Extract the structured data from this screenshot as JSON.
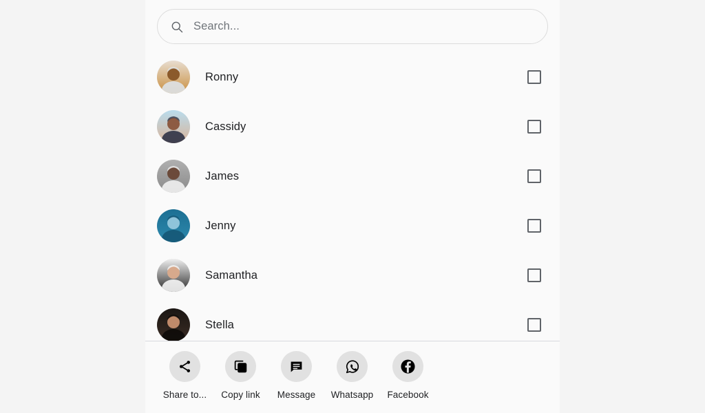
{
  "search": {
    "placeholder": "Search...",
    "value": "",
    "icon": "search-icon"
  },
  "contacts": [
    {
      "name": "Ronny",
      "checked": false,
      "avatar_colors": [
        "#e8ddd0",
        "#c98f3f",
        "#8b5a2b",
        "#dde4ea"
      ]
    },
    {
      "name": "Cassidy",
      "checked": false,
      "avatar_colors": [
        "#b9dced",
        "#d9b49a",
        "#8d5b43",
        "#2a2f43"
      ]
    },
    {
      "name": "James",
      "checked": false,
      "avatar_colors": [
        "#b0b0b0",
        "#8a8a8a",
        "#6b4a3a",
        "#f2f2f2"
      ]
    },
    {
      "name": "Jenny",
      "checked": false,
      "avatar_colors": [
        "#1c6f93",
        "#2d89ad",
        "#8fc4da",
        "#145574"
      ]
    },
    {
      "name": "Samantha",
      "checked": false,
      "avatar_colors": [
        "#efefef",
        "#2b2b2b",
        "#d7a98c",
        "#fafafa"
      ]
    },
    {
      "name": "Stella",
      "checked": false,
      "avatar_colors": [
        "#1b1613",
        "#3a2c24",
        "#c08a6a",
        "#0d0a08"
      ]
    }
  ],
  "share_actions": [
    {
      "label": "Share to...",
      "icon": "share-nodes-icon"
    },
    {
      "label": "Copy link",
      "icon": "copy-icon"
    },
    {
      "label": "Message",
      "icon": "message-bubble-icon"
    },
    {
      "label": "Whatsapp",
      "icon": "whatsapp-icon"
    },
    {
      "label": "Facebook",
      "icon": "facebook-icon"
    }
  ],
  "colors": {
    "page_background": "#f4f4f4",
    "sheet_background": "#fafafa",
    "text_primary": "#202124",
    "text_muted": "#70757a",
    "icon_circle": "#e1e1e1",
    "checkbox_border": "#5f6368",
    "divider": "#d7d8dd"
  }
}
